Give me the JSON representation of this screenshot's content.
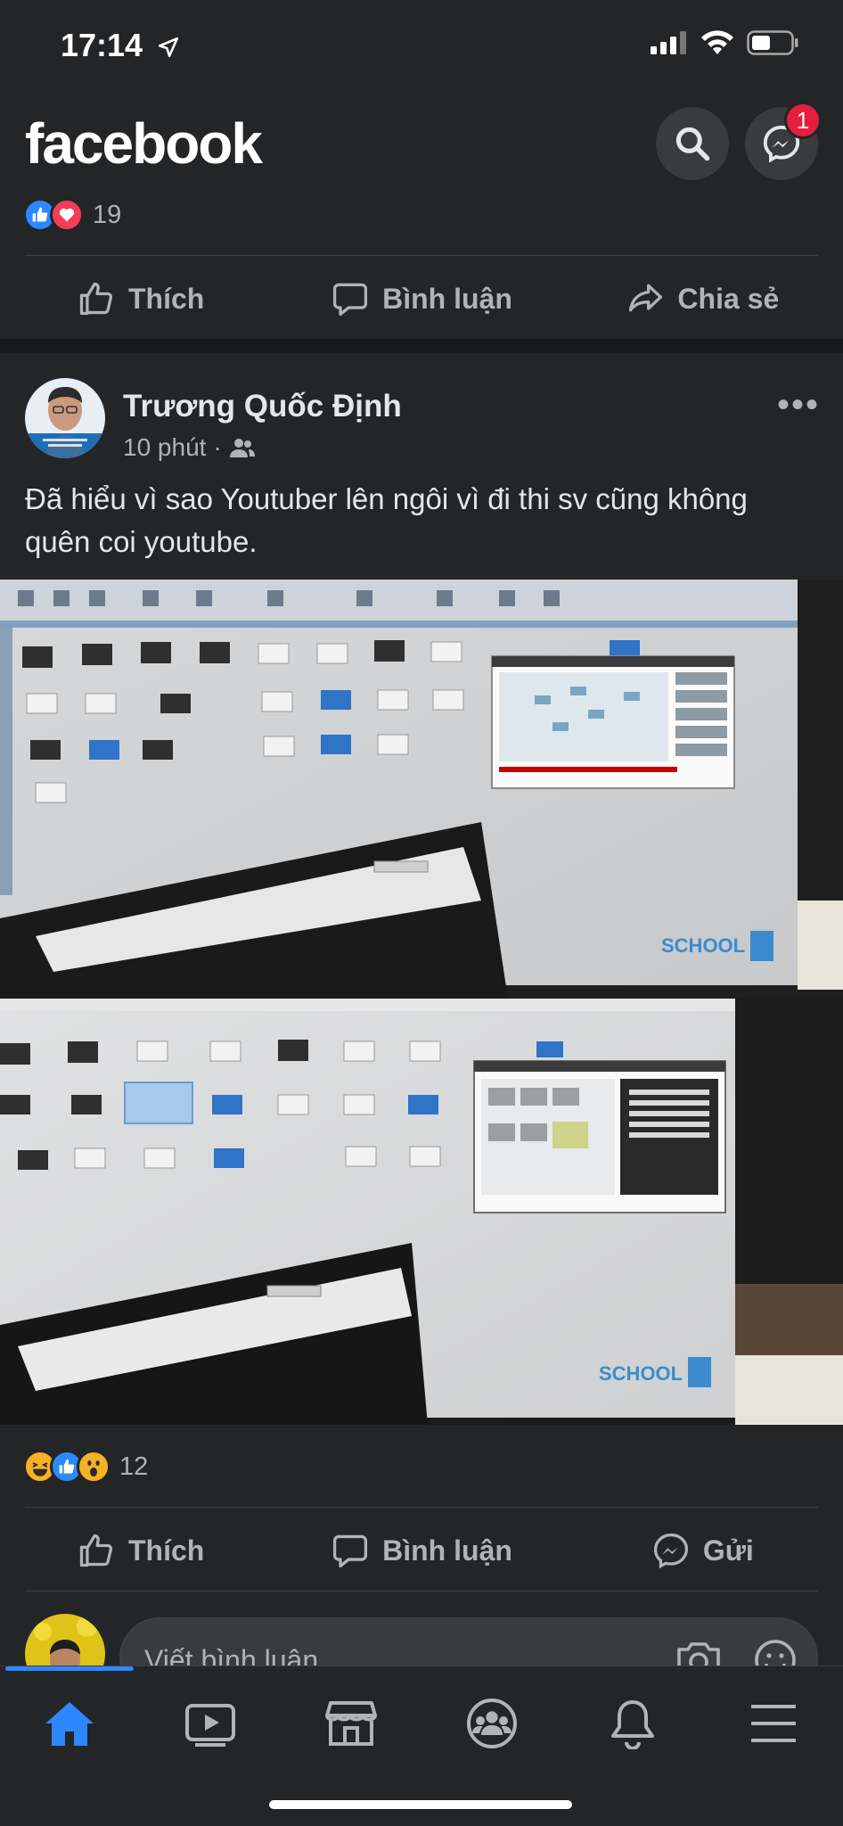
{
  "status_bar": {
    "time": "17:14"
  },
  "header": {
    "logo": "facebook",
    "messenger_badge": "1"
  },
  "prev_post": {
    "reaction_count": "19",
    "actions": {
      "like": "Thích",
      "comment": "Bình luận",
      "share": "Chia sẻ"
    }
  },
  "post": {
    "author": "Trương Quốc Định",
    "time": "10 phút",
    "meta_sep": "·",
    "text": "Đã hiểu vì sao Youtuber lên ngôi vì đi thi sv cũng không quên coi youtube.",
    "screen_brand": "SCHOOL",
    "reaction_count": "12",
    "actions": {
      "like": "Thích",
      "comment": "Bình luận",
      "send": "Gửi"
    }
  },
  "comment": {
    "placeholder": "Viết bình luận..."
  },
  "colors": {
    "background": "#242526",
    "accent": "#2d88ff",
    "badge": "#e41e3f",
    "secondary_text": "#b0b3b8"
  }
}
